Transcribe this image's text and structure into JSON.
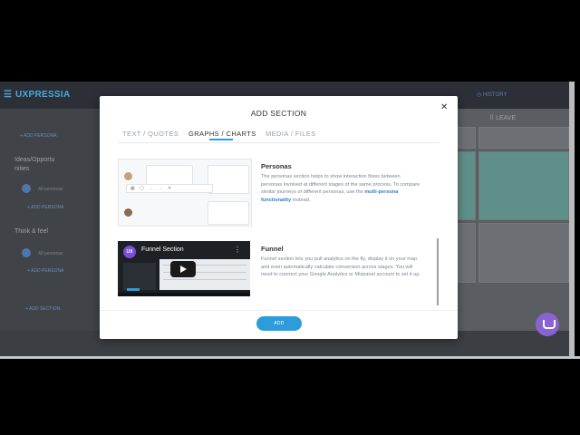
{
  "app": {
    "logo": "UXPRESSIA",
    "history_label": "HISTORY",
    "leave_label": "LEAVE"
  },
  "sidebar": {
    "add_persona_top": "+ ADD PERSONA",
    "stage1_title_line1": "Ideas/Opportu",
    "stage1_title_line2": "nities",
    "stage1_persona": "All personas",
    "stage1_add_persona": "+ ADD PERSONA",
    "stage2_title": "Think & feel",
    "stage2_persona": "All personas",
    "stage2_add_persona": "+ ADD PERSONA",
    "add_section": "+ ADD SECTION"
  },
  "modal": {
    "title": "ADD SECTION",
    "close_icon": "close-icon",
    "tabs": [
      {
        "label": "TEXT / QUOTES",
        "active": false
      },
      {
        "label": "GRAPHS / CHARTS",
        "active": true
      },
      {
        "label": "MEDIA / FILES",
        "active": false
      }
    ],
    "sections": [
      {
        "title": "Personas",
        "desc_part1": "The personas section helps to show interaction flows between personas involved at different stages of the same process. To compare similar journeys of different personas, use the ",
        "desc_link": "multi-persona functionality",
        "desc_part2": " instead."
      },
      {
        "title": "Funnel",
        "desc": "Funnel section lets you pull analytics on the fly, display it on your map and even automatically calculate conversion across stages. You will need to connect your Google Analytics or Mixpanel account to set it up.",
        "video_title": "Funnel Section",
        "video_logo": "UX"
      }
    ],
    "add_button": "ADD"
  },
  "colors": {
    "accent": "#2d9cdb",
    "chat": "#8a63d2"
  }
}
